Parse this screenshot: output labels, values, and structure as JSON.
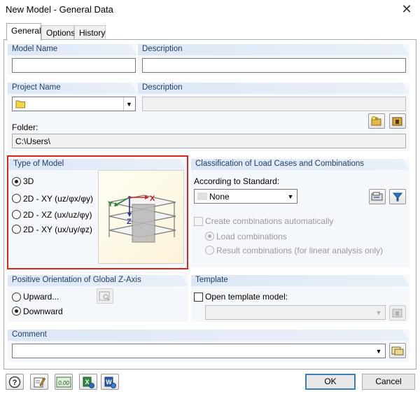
{
  "window": {
    "title": "New Model - General Data"
  },
  "tabs": [
    {
      "label": "General",
      "active": true
    },
    {
      "label": "Options",
      "active": false
    },
    {
      "label": "History",
      "active": false
    }
  ],
  "model_name": {
    "label": "Model Name",
    "value": ""
  },
  "description1": {
    "label": "Description",
    "value": ""
  },
  "project_name": {
    "label": "Project Name",
    "value": ""
  },
  "description2": {
    "label": "Description",
    "value": ""
  },
  "folder": {
    "label": "Folder:",
    "value": "C:\\Users\\"
  },
  "type_of_model": {
    "label": "Type of Model",
    "options": [
      {
        "label": "3D",
        "selected": true
      },
      {
        "label": "2D - XY (uz/φx/φy)",
        "selected": false
      },
      {
        "label": "2D - XZ (ux/uz/φy)",
        "selected": false
      },
      {
        "label": "2D - XY (ux/uy/φz)",
        "selected": false
      }
    ],
    "preview_axes": {
      "x": "X",
      "y": "Y",
      "z": "Z"
    }
  },
  "classification": {
    "label": "Classification of Load Cases and Combinations",
    "standard_label": "According to Standard:",
    "standard_value": "None",
    "create_auto_label": "Create combinations automatically",
    "load_combinations": "Load combinations",
    "result_combinations": "Result combinations (for linear analysis only)"
  },
  "orientation": {
    "label": "Positive Orientation of Global Z-Axis",
    "upward": "Upward...",
    "downward": "Downward"
  },
  "template": {
    "label": "Template",
    "open_label": "Open template model:"
  },
  "comment": {
    "label": "Comment",
    "value": ""
  },
  "buttons": {
    "ok": "OK",
    "cancel": "Cancel",
    "units_text": "0.00"
  },
  "colors": {
    "highlight_border": "#e0241b",
    "header_text": "#1f3e66",
    "accent": "#3c7fb1"
  }
}
